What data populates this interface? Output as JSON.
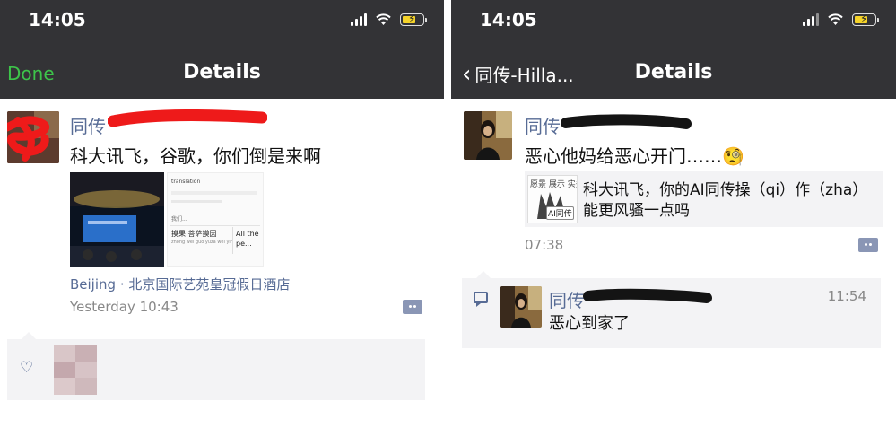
{
  "left": {
    "status": {
      "time": "14:05"
    },
    "nav": {
      "done_label": "Done",
      "title": "Details"
    },
    "post": {
      "author_name": "同传",
      "text": "科大讯飞，谷歌，你们倒是来啊",
      "screenshot_title": "translation",
      "screenshot_result_cn": "我们...",
      "screenshot_left": "摸果 菩萨摸因",
      "screenshot_pinyin": "zhong wei guo yuza wei yin",
      "screenshot_right": "All the pe... afraid of t...",
      "location": "Beijing · 北京国际艺苑皇冠假日酒店",
      "time": "Yesterday 10:43"
    },
    "likes": {
      "icon": "heart-icon"
    }
  },
  "right": {
    "status": {
      "time": "14:05"
    },
    "nav": {
      "back_label": "同传-Hilla...",
      "title": "Details"
    },
    "post": {
      "author_name": "同传",
      "text": "恶心他妈给恶心开门……🧐",
      "share_thumb_tabs": "愿景 展示 实务",
      "share_thumb_label": "AI同传",
      "share_text": "科大讯飞，你的AI同传操（qi）作（zha）能更风骚一点吗",
      "time": "07:38"
    },
    "reply": {
      "author_name": "同传",
      "time": "11:54",
      "text": "恶心到家了"
    }
  },
  "colors": {
    "nav_bar": "#333336",
    "link_blue": "#576b95",
    "done_green": "#3dc44a",
    "redaction_red": "#ee1a1a",
    "redaction_black": "#141414",
    "panel_gray": "#f3f3f5"
  }
}
